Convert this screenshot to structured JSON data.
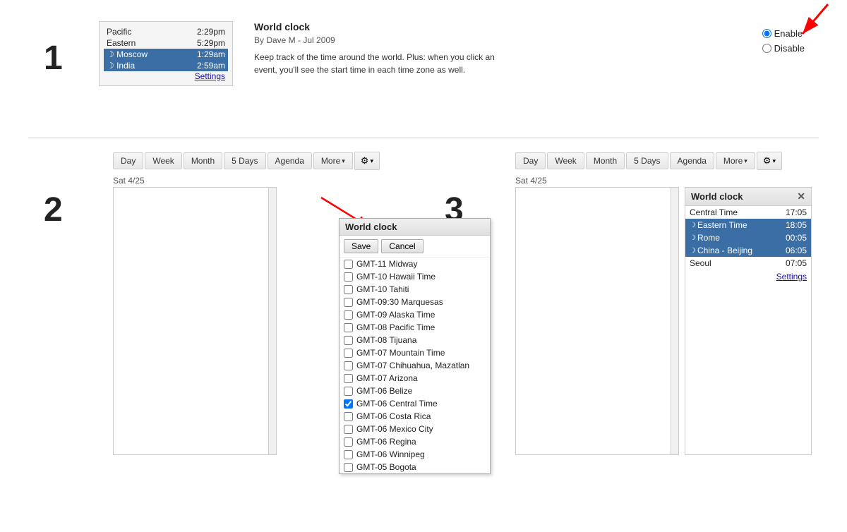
{
  "section1": {
    "number": "1",
    "widget": {
      "rows": [
        {
          "label": "Pacific",
          "time": "2:29pm",
          "highlight": false,
          "moon": false
        },
        {
          "label": "Eastern",
          "time": "5:29pm",
          "highlight": false,
          "moon": false
        },
        {
          "label": "Moscow",
          "time": "1:29am",
          "highlight": true,
          "moon": true
        },
        {
          "label": "India",
          "time": "2:59am",
          "highlight": true,
          "moon": true
        }
      ],
      "settings_label": "Settings"
    },
    "addon": {
      "title": "World clock",
      "author": "By Dave M - Jul 2009",
      "description": "Keep track of the time around the world. Plus: when you click an event, you'll see the start time in each time zone as well."
    },
    "enable_label": "Enable",
    "disable_label": "Disable"
  },
  "section2": {
    "number": "2",
    "toolbar": {
      "day": "Day",
      "week": "Week",
      "month": "Month",
      "fivedays": "5 Days",
      "agenda": "Agenda",
      "more": "More",
      "gear": "⚙"
    },
    "date_header": "Sat 4/25",
    "popup": {
      "title": "World clock",
      "save": "Save",
      "cancel": "Cancel",
      "items": [
        {
          "label": "GMT-11 Midway",
          "checked": false
        },
        {
          "label": "GMT-10 Hawaii Time",
          "checked": false
        },
        {
          "label": "GMT-10 Tahiti",
          "checked": false
        },
        {
          "label": "GMT-09:30 Marquesas",
          "checked": false
        },
        {
          "label": "GMT-09 Alaska Time",
          "checked": false
        },
        {
          "label": "GMT-08 Pacific Time",
          "checked": false
        },
        {
          "label": "GMT-08 Tijuana",
          "checked": false
        },
        {
          "label": "GMT-07 Mountain Time",
          "checked": false
        },
        {
          "label": "GMT-07 Chihuahua, Mazatlan",
          "checked": false
        },
        {
          "label": "GMT-07 Arizona",
          "checked": false
        },
        {
          "label": "GMT-06 Belize",
          "checked": false
        },
        {
          "label": "GMT-06 Central Time",
          "checked": true
        },
        {
          "label": "GMT-06 Costa Rica",
          "checked": false
        },
        {
          "label": "GMT-06 Mexico City",
          "checked": false
        },
        {
          "label": "GMT-06 Regina",
          "checked": false
        },
        {
          "label": "GMT-06 Winnipeg",
          "checked": false
        },
        {
          "label": "GMT-05 Bogota",
          "checked": false
        }
      ]
    }
  },
  "section3": {
    "number": "3",
    "toolbar": {
      "day": "Day",
      "week": "Week",
      "month": "Month",
      "fivedays": "5 Days",
      "agenda": "Agenda",
      "more": "More",
      "gear": "⚙"
    },
    "date_header": "Sat 4/25",
    "panel": {
      "title": "World clock",
      "rows": [
        {
          "label": "Central Time",
          "time": "17:05",
          "highlight": false,
          "moon": false
        },
        {
          "label": "Eastern Time",
          "time": "18:05",
          "highlight": true,
          "moon": true
        },
        {
          "label": "Rome",
          "time": "00:05",
          "highlight": true,
          "moon": true
        },
        {
          "label": "China - Beijing",
          "time": "06:05",
          "highlight": true,
          "moon": true
        },
        {
          "label": "Seoul",
          "time": "07:05",
          "highlight": false,
          "moon": false
        }
      ],
      "settings_label": "Settings"
    }
  }
}
